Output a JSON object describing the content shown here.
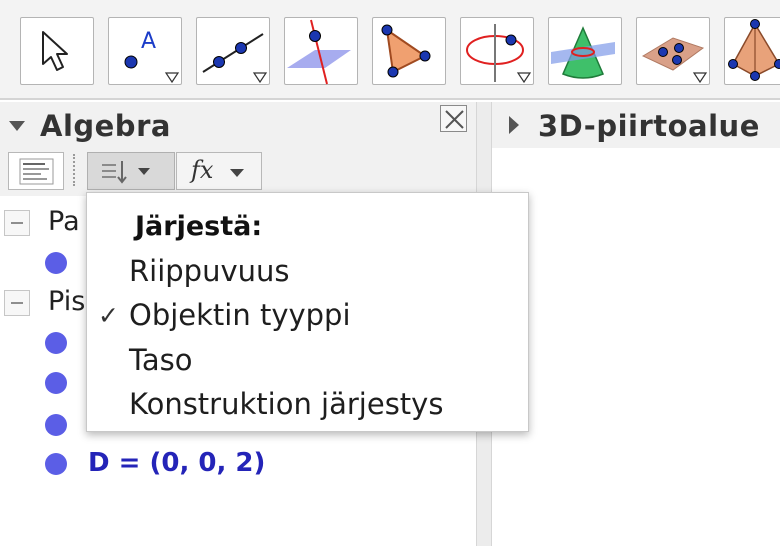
{
  "toolbar": {
    "tools": [
      {
        "icon": "move-arrow-icon"
      },
      {
        "icon": "point-icon",
        "label": "A"
      },
      {
        "icon": "line-icon"
      },
      {
        "icon": "perpendicular-line-icon"
      },
      {
        "icon": "polygon-icon"
      },
      {
        "icon": "circle-axis-icon"
      },
      {
        "icon": "cone-intersect-icon"
      },
      {
        "icon": "plane-points-icon"
      },
      {
        "icon": "pyramid-icon"
      }
    ]
  },
  "algebra": {
    "title": "Algebra",
    "groups": [
      {
        "label": "Pa"
      },
      {
        "label": "Pis"
      }
    ],
    "items": [
      {
        "text": "D = (0, 0, 2)"
      }
    ]
  },
  "view3d": {
    "title": "3D-piirtoalue"
  },
  "sort_menu": {
    "heading": "Järjestä:",
    "options": [
      "Riippuvuus",
      "Objektin tyyppi",
      "Taso",
      "Konstruktion järjestys"
    ],
    "selected": "Objektin tyyppi",
    "check_glyph": "✓"
  },
  "colors": {
    "accent_point": "#5b5ee6",
    "object_text": "#2424b8"
  }
}
